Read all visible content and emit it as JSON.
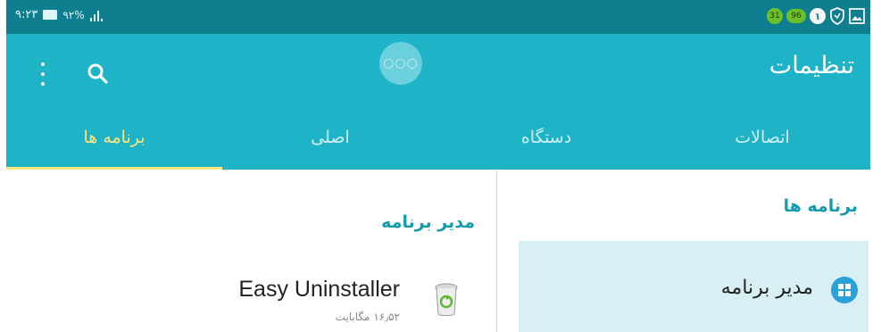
{
  "status_bar": {
    "time": "۹:۲۳",
    "battery_percent": "۹۲%",
    "notif_green_circle": "31",
    "notif_green_rect": "96",
    "notif_white_circle": "۱"
  },
  "app_bar": {
    "title": "تنظیمات",
    "center_bubble": "○○○"
  },
  "tabs": [
    {
      "label": "اتصالات",
      "active": false
    },
    {
      "label": "دستگاه",
      "active": false
    },
    {
      "label": "اصلی",
      "active": false
    },
    {
      "label": "برنامه ها",
      "active": true
    }
  ],
  "left_panel": {
    "section_title": "مدیر برنامه",
    "app": {
      "name": "Easy Uninstaller",
      "size": "۱۶٫۵۲ مگابایت"
    }
  },
  "right_panel": {
    "section_title": "برنامه ها",
    "menu_item_label": "مدیر برنامه"
  },
  "colors": {
    "status_bar": "#0f7f8f",
    "app_bar": "#1fb3c7",
    "active_tab": "#ffe57a",
    "accent_text": "#159bb0",
    "selected_row": "#d8f0f4"
  }
}
